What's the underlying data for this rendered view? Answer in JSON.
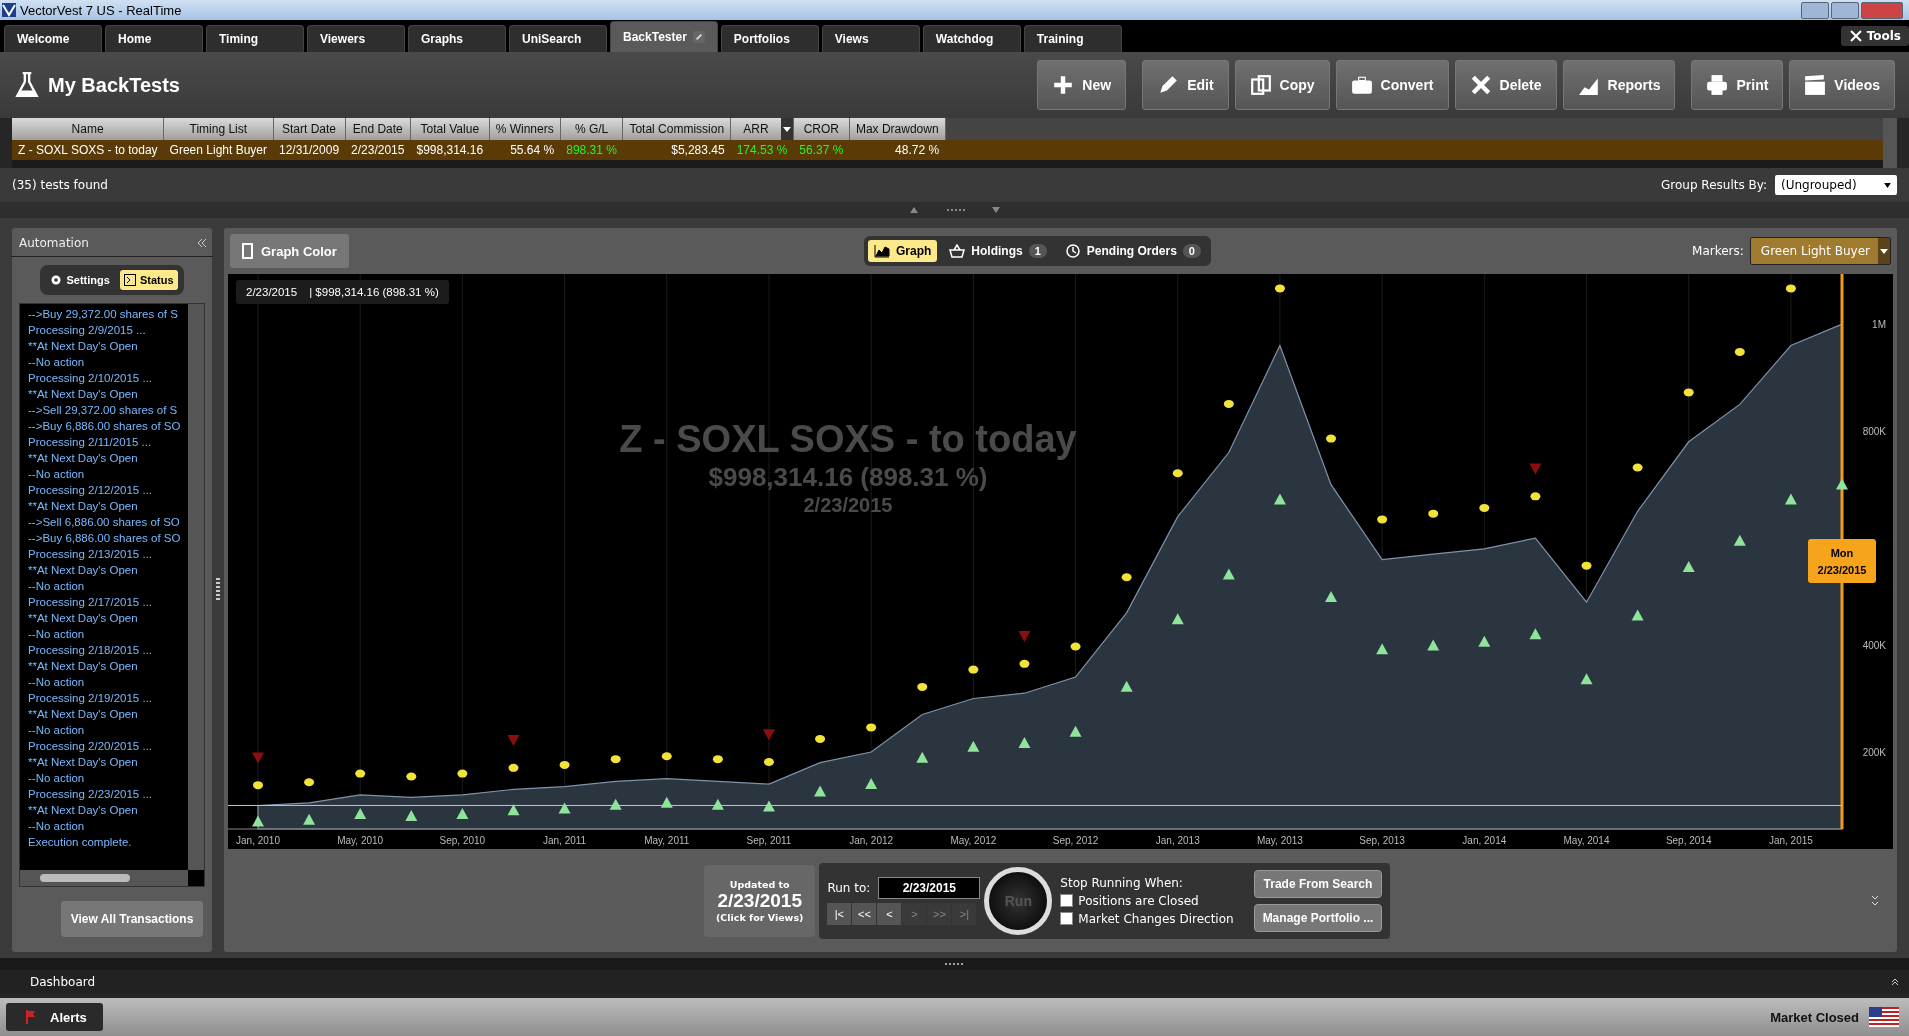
{
  "titlebar": {
    "title": "VectorVest 7 US - RealTime"
  },
  "tabs": [
    {
      "label": "Welcome",
      "selected": false
    },
    {
      "label": "Home",
      "selected": false
    },
    {
      "label": "Timing",
      "selected": false
    },
    {
      "label": "Viewers",
      "selected": false
    },
    {
      "label": "Graphs",
      "selected": false
    },
    {
      "label": "UniSearch",
      "selected": false
    },
    {
      "label": "BackTester",
      "selected": true
    },
    {
      "label": "Portfolios",
      "selected": false
    },
    {
      "label": "Views",
      "selected": false
    },
    {
      "label": "Watchdog",
      "selected": false
    },
    {
      "label": "Training",
      "selected": false
    }
  ],
  "tools": "Tools",
  "page_title": "My BackTests",
  "toolbar": [
    {
      "label": "New",
      "kind": "plus"
    },
    {
      "label": "Edit",
      "kind": "pencil"
    },
    {
      "label": "Copy",
      "kind": "copy"
    },
    {
      "label": "Convert",
      "kind": "case"
    },
    {
      "label": "Delete",
      "kind": "cross"
    },
    {
      "label": "Reports",
      "kind": "chart"
    },
    {
      "label": "Print",
      "kind": "printer"
    },
    {
      "label": "Videos",
      "kind": "film"
    }
  ],
  "table": {
    "columns": [
      "Name",
      "Timing List",
      "Start Date",
      "End Date",
      "Total Value",
      "% Winners",
      "% G/L",
      "Total Commission",
      "ARR",
      "CROR",
      "Max Drawdown"
    ],
    "rows": [
      {
        "selected": true,
        "cells": [
          {
            "text": "Z - SOXL SOXS - to today",
            "kind": "plain"
          },
          {
            "text": "Green Light Buyer",
            "kind": "plain"
          },
          {
            "text": "12/31/2009",
            "kind": "plain"
          },
          {
            "text": "2/23/2015",
            "kind": "plain"
          },
          {
            "text": "$998,314.16",
            "kind": "plain"
          },
          {
            "text": "55.64 %",
            "kind": "plain"
          },
          {
            "text": "898.31 %",
            "kind": "gain"
          },
          {
            "text": "$5,283.45",
            "kind": "plain"
          },
          {
            "text": "174.53 %",
            "kind": "gain"
          },
          {
            "text": "56.37 %",
            "kind": "gain"
          },
          {
            "text": "48.72 %",
            "kind": "plain"
          }
        ]
      }
    ]
  },
  "tests_found": "(35) tests found",
  "group_by": {
    "label": "Group Results By:",
    "value": "(Ungrouped)"
  },
  "automation": {
    "title": "Automation",
    "tabs": [
      {
        "label": "Settings",
        "kind": "gear",
        "selected": false
      },
      {
        "label": "Status",
        "kind": "console",
        "selected": true
      }
    ],
    "log": [
      "-->Buy 29,372.00 shares of S",
      "Processing 2/9/2015 ...",
      "**At Next Day's Open",
      "--No action",
      "Processing 2/10/2015 ...",
      "**At Next Day's Open",
      "-->Sell 29,372.00 shares of S",
      "-->Buy 6,886.00 shares of SO",
      "Processing 2/11/2015 ...",
      "**At Next Day's Open",
      "--No action",
      "Processing 2/12/2015 ...",
      "**At Next Day's Open",
      "-->Sell 6,886.00 shares of SO",
      "-->Buy 6,886.00 shares of SO",
      "Processing 2/13/2015 ...",
      "**At Next Day's Open",
      "--No action",
      "Processing 2/17/2015 ...",
      "**At Next Day's Open",
      "--No action",
      "Processing 2/18/2015 ...",
      "**At Next Day's Open",
      "--No action",
      "Processing 2/19/2015 ...",
      "**At Next Day's Open",
      "--No action",
      "Processing 2/20/2015 ...",
      "**At Next Day's Open",
      "--No action",
      "Processing 2/23/2015 ...",
      "**At Next Day's Open",
      "--No action",
      "Execution complete."
    ],
    "button": "View All Transactions"
  },
  "graph_color": "Graph Color",
  "view_tabs": [
    {
      "label": "Graph",
      "kind": "graph",
      "selected": true
    },
    {
      "label": "Holdings",
      "kind": "basket",
      "count": "1",
      "selected": false
    },
    {
      "label": "Pending Orders",
      "kind": "clock",
      "count": "0",
      "selected": false
    }
  ],
  "markers": {
    "label": "Markers:",
    "value": "Green Light Buyer"
  },
  "chart": {
    "tooltip_date": "2/23/2015",
    "tooltip_value": "| $998,314.16 (898.31 %)",
    "overlay": [
      "Z - SOXL SOXS - to today",
      "$998,314.16 (898.31 %)",
      "2/23/2015"
    ],
    "cursor": {
      "day": "Mon",
      "date": "2/23/2015"
    },
    "chart_data": {
      "type": "area",
      "categories": [
        "Jan, 2010",
        null,
        "May, 2010",
        null,
        "Sep, 2010",
        null,
        "Jan, 2011",
        null,
        "May, 2011",
        null,
        "Sep, 2011",
        null,
        "Jan, 2012",
        null,
        "May, 2012",
        null,
        "Sep, 2012",
        null,
        "Jan, 2013",
        null,
        "May, 2013",
        null,
        "Sep, 2013",
        null,
        "Jan, 2014",
        null,
        "May, 2014",
        null,
        "Sep, 2014",
        null,
        "Jan, 2015",
        null
      ],
      "series": [
        {
          "color": "#2b3540",
          "values": [
            100000,
            105000,
            120000,
            115000,
            120000,
            130000,
            135000,
            145000,
            150000,
            145000,
            140000,
            180000,
            200000,
            270000,
            300000,
            310000,
            340000,
            460000,
            640000,
            760000,
            960000,
            700000,
            560000,
            570000,
            580000,
            600000,
            480000,
            650000,
            780000,
            850000,
            960000,
            1000000
          ]
        }
      ],
      "grid": true,
      "ylim": [
        56000,
        1090000
      ],
      "yticks": [
        {
          "value": 200000,
          "label": "200K"
        },
        {
          "value": 400000,
          "label": "400K"
        },
        {
          "value": 800000,
          "label": "800K"
        },
        {
          "value": 1000000,
          "label": "1M"
        }
      ]
    }
  },
  "run_panel": {
    "updated_label": "Updated to",
    "updated_date": "2/23/2015",
    "updated_hint": "(Click for Views)",
    "run_to_label": "Run to:",
    "run_to": "2/23/2015",
    "nav": [
      {
        "label": "|<",
        "disabled": false
      },
      {
        "label": "<<",
        "disabled": false
      },
      {
        "label": "<",
        "disabled": false
      },
      {
        "label": ">",
        "disabled": true
      },
      {
        "label": ">>",
        "disabled": true
      },
      {
        "label": ">|",
        "disabled": true
      }
    ],
    "run": "Run",
    "stop_title": "Stop Running When:",
    "stop_options": [
      {
        "label": "Positions are Closed",
        "checked": false
      },
      {
        "label": "Market Changes Direction",
        "checked": false
      }
    ],
    "actions": [
      "Trade From Search",
      "Manage Portfolio ..."
    ]
  },
  "dashboard": "Dashboard",
  "alerts": "Alerts",
  "market_status": "Market Closed"
}
